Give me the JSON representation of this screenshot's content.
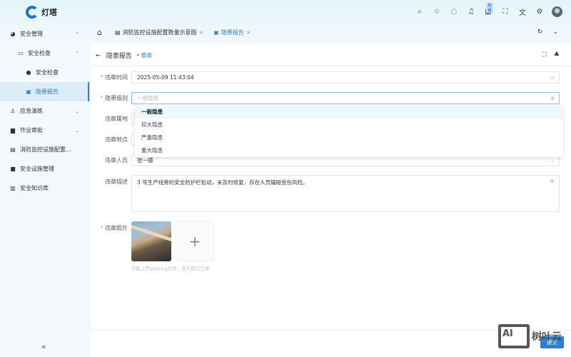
{
  "app": {
    "name": "灯塔",
    "watermark": "AI 树叶云",
    "accent": "#2b7fd1"
  },
  "topbar": {
    "icons": [
      "search-icon",
      "star-icon",
      "message-icon",
      "bell-icon",
      "apps-icon",
      "fullscreen-icon",
      "translate-icon",
      "settings-icon"
    ],
    "apps_badge": "应用"
  },
  "sidebar": {
    "items": [
      {
        "label": "安全管理",
        "icon": "globe-icon",
        "level": 0,
        "chev": "⌃"
      },
      {
        "label": "安全检查",
        "icon": "calendar-icon",
        "level": 1,
        "chev": "⌃"
      },
      {
        "label": "安全检查",
        "icon": "check-circle-icon",
        "level": 2
      },
      {
        "label": "隐患报告",
        "icon": "document-icon",
        "level": 2,
        "active": true
      },
      {
        "label": "应急演练",
        "icon": "user-icon",
        "level": 0,
        "chev": "⌄"
      },
      {
        "label": "作业审批",
        "icon": "approval-icon",
        "level": 0,
        "chev": "⌄"
      },
      {
        "label": "消防监控设施配置...",
        "icon": "chart-icon",
        "level": 0
      },
      {
        "label": "安全设施管理",
        "icon": "square-icon",
        "level": 0
      },
      {
        "label": "安全知识库",
        "icon": "book-icon",
        "level": 0
      }
    ],
    "collapse": "«"
  },
  "tabs": [
    {
      "label": "消防监控设施配置数量示意图",
      "close": "×"
    },
    {
      "label": "隐患报告",
      "close": "×",
      "active": true
    }
  ],
  "page": {
    "title": "隐患报告",
    "badge": "• 普通"
  },
  "form": {
    "time": {
      "label": "违章时间",
      "value": "2025-05-09 11:43:04"
    },
    "level": {
      "label": "隐患级别",
      "placeholder": "一般隐患",
      "options": [
        "一般隐患",
        "较大隐患",
        "严重隐患",
        "重大隐患"
      ],
      "selected": "一般隐患"
    },
    "area": {
      "label": "违章属地"
    },
    "place": {
      "label": "违章地点"
    },
    "person": {
      "label": "违章人员",
      "value": "张一德"
    },
    "desc": {
      "label": "违章描述",
      "value": "3 号生产线旁的安全防护栏松动，未及时修复，存在人员磕碰受伤风险。"
    },
    "photo": {
      "label": "违章照片",
      "hint": "只能上传jpg/png文件，且不超过三张",
      "add": "+"
    }
  },
  "submit": "提交"
}
